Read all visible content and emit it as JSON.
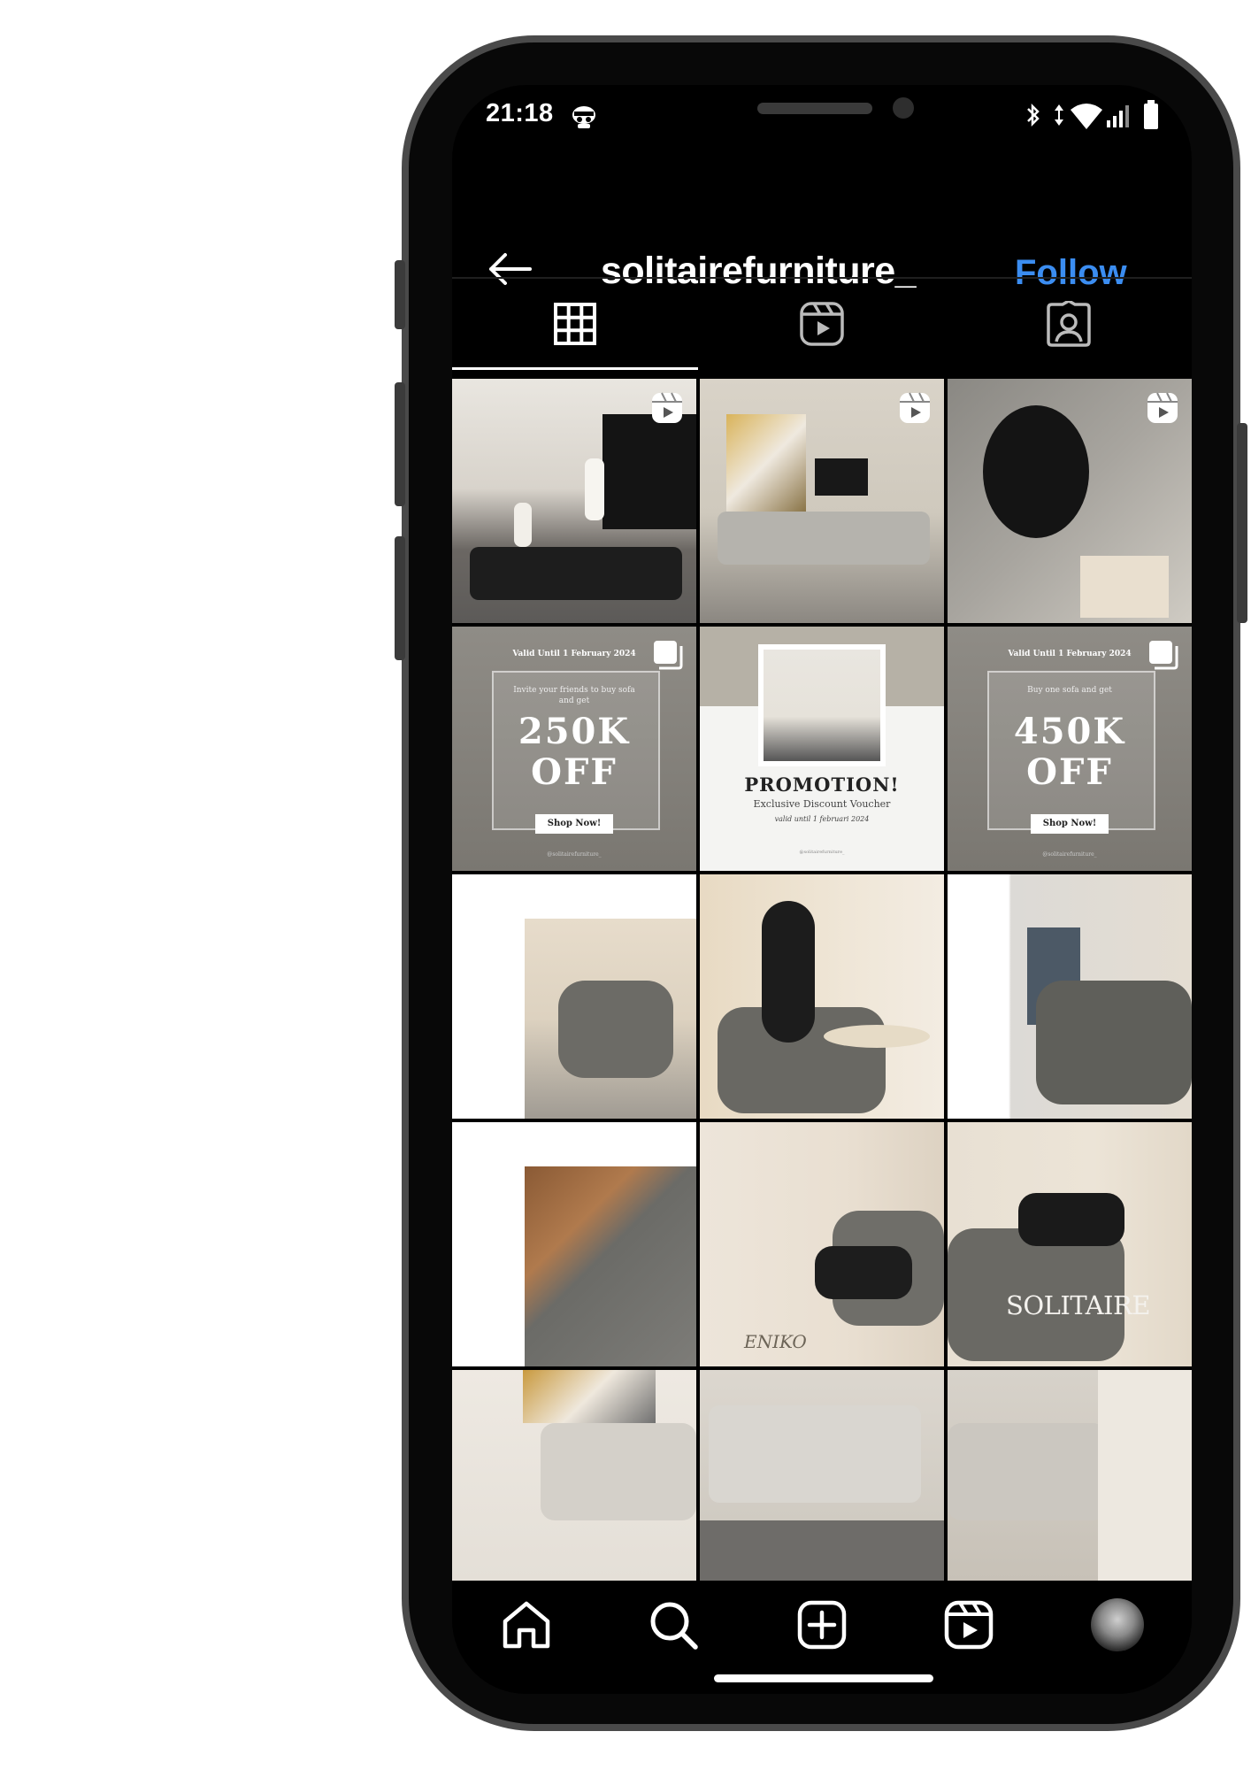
{
  "status_bar": {
    "time": "21:18"
  },
  "header": {
    "username": "solitairefurniture_",
    "follow_label": "Follow"
  },
  "tabs": [
    {
      "name": "posts-grid",
      "active": true
    },
    {
      "name": "reels",
      "active": false
    },
    {
      "name": "tagged",
      "active": false
    }
  ],
  "posts": {
    "promo1": {
      "valid": "Valid Until 1 February 2024",
      "sub": "Invite your friends to buy sofa and get",
      "big_line1": "250K",
      "big_line2": "OFF",
      "shop": "Shop Now!",
      "handle": "@solitairefurniture_"
    },
    "promo2": {
      "title": "PROMOTION!",
      "subtitle": "Exclusive Discount Voucher",
      "valid": "valid until 1 februari 2024",
      "handle": "@solitairefurniture_"
    },
    "promo3": {
      "valid": "Valid Until 1 February 2024",
      "sub": "Buy one sofa and get",
      "big_line1": "450K",
      "big_line2": "OFF",
      "shop": "Shop Now!",
      "handle": "@solitairefurniture_"
    },
    "brand_logo_text": "SOLITAIRE",
    "model_label": "ENIKO"
  },
  "colors": {
    "follow": "#3b8df1",
    "background": "#000000",
    "frame": "#4a4a4a"
  }
}
